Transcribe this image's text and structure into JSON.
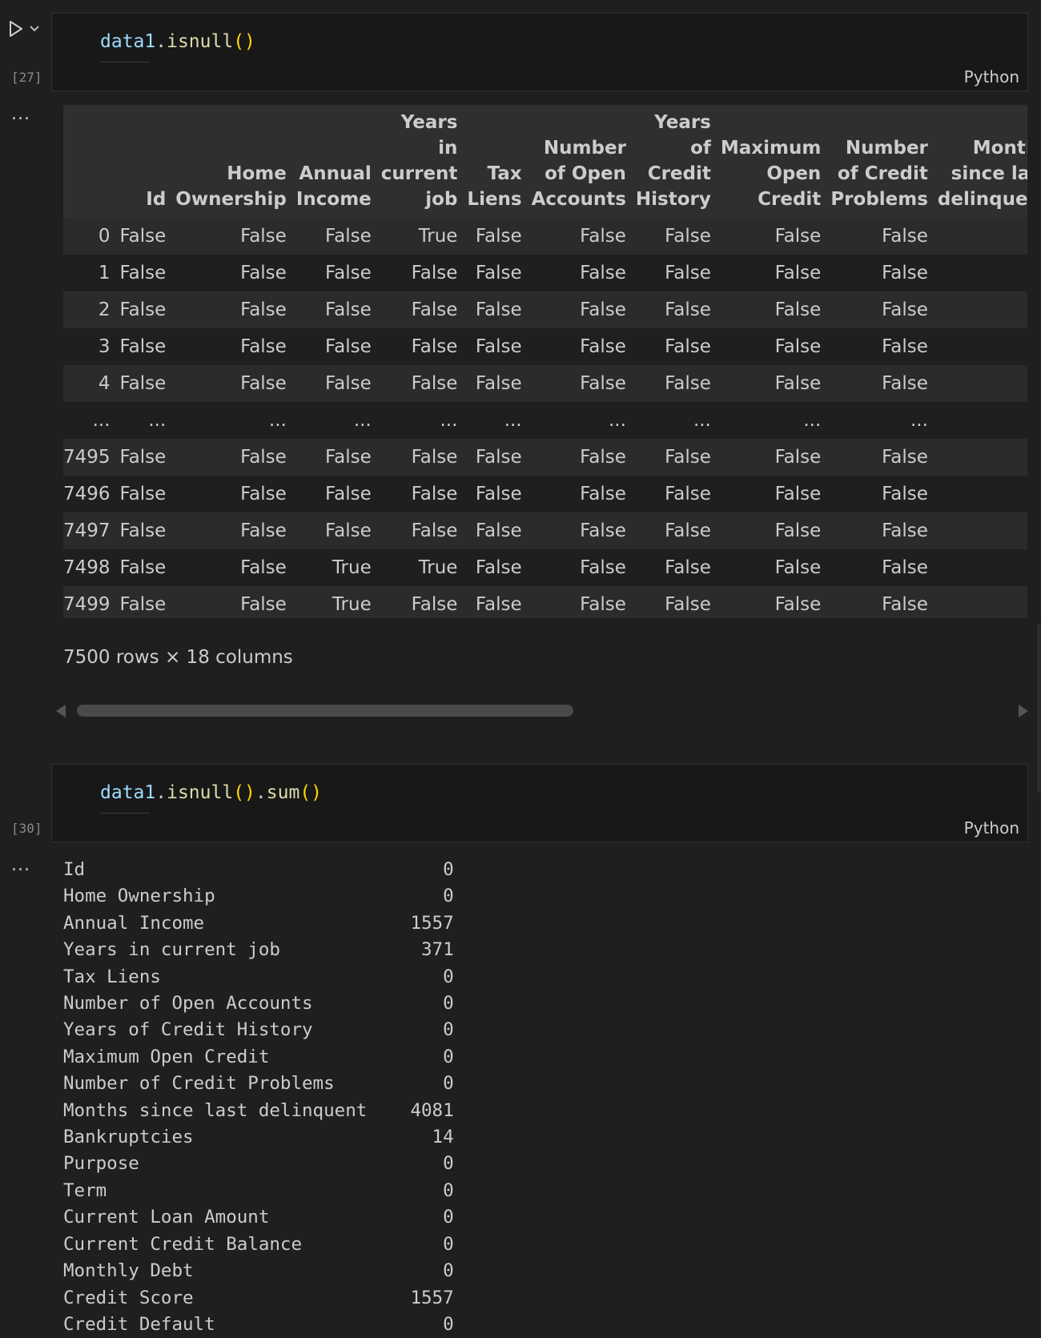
{
  "cells": [
    {
      "execution_count": "[27]",
      "code": {
        "var": "data1",
        "dot": ".",
        "fn": "isnull",
        "paren": "()"
      },
      "language": "Python",
      "output_marker": "...",
      "dataframe": {
        "columns": [
          "",
          "Id",
          "Home Ownership",
          "Annual Income",
          "Years in current job",
          "Tax Liens",
          "Number of Open Accounts",
          "Years of Credit History",
          "Maximum Open Credit",
          "Number of Credit Problems",
          "Months since last delinquent"
        ],
        "rows": [
          [
            "0",
            "False",
            "False",
            "False",
            "True",
            "False",
            "False",
            "False",
            "False",
            "False",
            ""
          ],
          [
            "1",
            "False",
            "False",
            "False",
            "False",
            "False",
            "False",
            "False",
            "False",
            "False",
            ""
          ],
          [
            "2",
            "False",
            "False",
            "False",
            "False",
            "False",
            "False",
            "False",
            "False",
            "False",
            ""
          ],
          [
            "3",
            "False",
            "False",
            "False",
            "False",
            "False",
            "False",
            "False",
            "False",
            "False",
            ""
          ],
          [
            "4",
            "False",
            "False",
            "False",
            "False",
            "False",
            "False",
            "False",
            "False",
            "False",
            ""
          ],
          [
            "...",
            "...",
            "...",
            "...",
            "...",
            "...",
            "...",
            "...",
            "...",
            "...",
            ""
          ],
          [
            "7495",
            "False",
            "False",
            "False",
            "False",
            "False",
            "False",
            "False",
            "False",
            "False",
            ""
          ],
          [
            "7496",
            "False",
            "False",
            "False",
            "False",
            "False",
            "False",
            "False",
            "False",
            "False",
            ""
          ],
          [
            "7497",
            "False",
            "False",
            "False",
            "False",
            "False",
            "False",
            "False",
            "False",
            "False",
            ""
          ],
          [
            "7498",
            "False",
            "False",
            "True",
            "True",
            "False",
            "False",
            "False",
            "False",
            "False",
            ""
          ],
          [
            "7499",
            "False",
            "False",
            "True",
            "False",
            "False",
            "False",
            "False",
            "False",
            "False",
            ""
          ]
        ],
        "caption": "7500 rows × 18 columns"
      }
    },
    {
      "execution_count": "[30]",
      "code": {
        "var": "data1",
        "dot": ".",
        "fn": "isnull",
        "paren": "()",
        "dot2": ".",
        "fn2": "sum",
        "paren2": "()"
      },
      "language": "Python",
      "output_marker": "...",
      "series": [
        {
          "name": "Id",
          "value": "0"
        },
        {
          "name": "Home Ownership",
          "value": "0"
        },
        {
          "name": "Annual Income",
          "value": "1557"
        },
        {
          "name": "Years in current job",
          "value": "371"
        },
        {
          "name": "Tax Liens",
          "value": "0"
        },
        {
          "name": "Number of Open Accounts",
          "value": "0"
        },
        {
          "name": "Years of Credit History",
          "value": "0"
        },
        {
          "name": "Maximum Open Credit",
          "value": "0"
        },
        {
          "name": "Number of Credit Problems",
          "value": "0"
        },
        {
          "name": "Months since last delinquent",
          "value": "4081"
        },
        {
          "name": "Bankruptcies",
          "value": "14"
        },
        {
          "name": "Purpose",
          "value": "0"
        },
        {
          "name": "Term",
          "value": "0"
        },
        {
          "name": "Current Loan Amount",
          "value": "0"
        },
        {
          "name": "Current Credit Balance",
          "value": "0"
        },
        {
          "name": "Monthly Debt",
          "value": "0"
        },
        {
          "name": "Credit Score",
          "value": "1557"
        },
        {
          "name": "Credit Default",
          "value": "0"
        }
      ]
    }
  ]
}
